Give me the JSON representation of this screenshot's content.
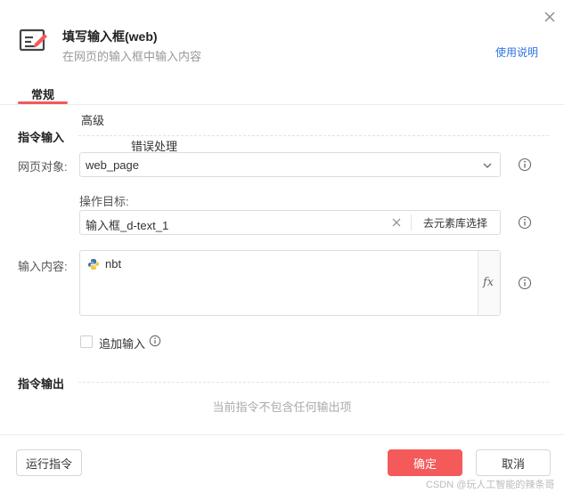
{
  "header": {
    "title": "填写输入框(web)",
    "subtitle": "在网页的输入框中输入内容",
    "help_link": "使用说明",
    "icon": "edit-form-icon",
    "close_icon": "close-icon"
  },
  "tabs": [
    {
      "label": "常规",
      "active": true
    },
    {
      "label": "高级",
      "active": false
    },
    {
      "label": "错误处理",
      "active": false
    }
  ],
  "input_section": {
    "title": "指令输入",
    "web_object": {
      "label": "网页对象:",
      "value": "web_page"
    },
    "target": {
      "label": "操作目标:",
      "value": "输入框_d-text_1",
      "pick_label": "去元素库选择"
    },
    "content": {
      "label": "输入内容:",
      "value": "nbt",
      "fx_label": "fx"
    },
    "append": {
      "label": "追加输入",
      "checked": false
    }
  },
  "output_section": {
    "title": "指令输出",
    "empty_text": "当前指令不包含任何输出项"
  },
  "footer": {
    "run_label": "运行指令",
    "ok_label": "确定",
    "cancel_label": "取消"
  },
  "watermark": "CSDN @玩人工智能的辣条哥",
  "colors": {
    "accent": "#f45a5a",
    "link": "#2f74e0"
  }
}
